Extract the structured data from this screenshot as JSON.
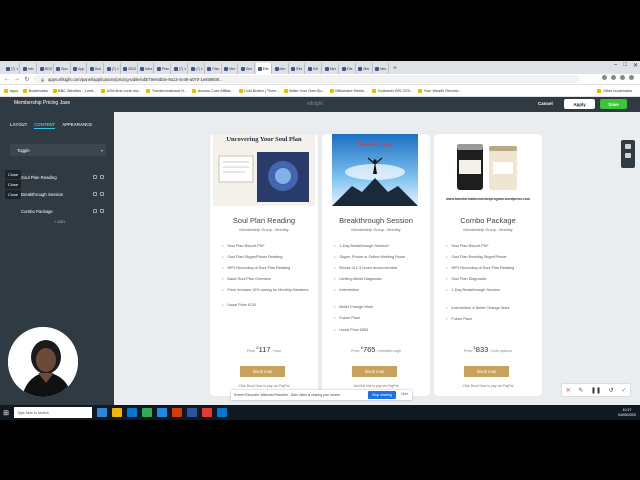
{
  "browser": {
    "tabs": [
      {
        "label": "(7) 1"
      },
      {
        "label": "Info"
      },
      {
        "label": "BOO"
      },
      {
        "label": "Boo"
      },
      {
        "label": "App"
      },
      {
        "label": "Soli"
      },
      {
        "label": "(7) 1"
      },
      {
        "label": "BOO"
      },
      {
        "label": "Inbo"
      },
      {
        "label": "Plan"
      },
      {
        "label": "(7) 1"
      },
      {
        "label": "(7) 1"
      },
      {
        "label": "Plan"
      },
      {
        "label": "Mer"
      },
      {
        "label": "Seo"
      },
      {
        "label": "Elfs"
      },
      {
        "label": "Mer"
      },
      {
        "label": "Elfs"
      },
      {
        "label": "Edi"
      },
      {
        "label": "Mer"
      },
      {
        "label": "Elfs"
      },
      {
        "label": "Mer"
      },
      {
        "label": "Mer"
      }
    ],
    "url": "apps.elfsight.com/panel/applications/pricing-table/edit/79e94b0e-9a13-4e49-a070-1e659806...",
    "bookmarks": [
      "Apps",
      "Bookmarks",
      "BBC Weather - Lond...",
      "USA time zone ma...",
      "Transformational N...",
      "Access Core Affiliat...",
      "Cold Button | Thea...",
      "Make Your Own Bu...",
      "Millionaire Mento...",
      "Godomex BIS-CE0...",
      "Your Wealth Revolut..."
    ],
    "other_bookmarks": "Other bookmarks"
  },
  "app": {
    "widget_name": "Membership Pricing Jase",
    "brand": "elfsight",
    "cancel_label": "Cancel",
    "apply_label": "Apply",
    "save_label": "Save"
  },
  "panel": {
    "tabs": [
      "LAYOUT",
      "CONTENT",
      "APPEARANCE"
    ],
    "active_tab": "CONTENT",
    "toggle_label": "Toggle",
    "items": [
      "Soul Plan Reading",
      "Breakthrough Session",
      "Combo Package"
    ],
    "add_label": "+ ADD",
    "close_tips": [
      "Close",
      "Close",
      "Close"
    ]
  },
  "cards": [
    {
      "image_title": "Uncovering Your Soul Plan",
      "name": "Soul Plan Reading",
      "subtitle": "Membership Group - Monthly",
      "features": [
        "Soul Plan Report PDF",
        "Soul Plan Skype/Phone Reading",
        "MP3 Recording of Soul Plan Reading",
        "Basic Soul Plan Overview",
        "Price includes 10% saving for Monthly Members",
        "Usual Price £130"
      ],
      "price_prefix": "Price",
      "currency": "£",
      "amount": "117",
      "period": "/ hour",
      "button": "Book now",
      "footnote": "Click Book Now to pay via PayPal"
    },
    {
      "image_title": "Breakthrough",
      "name": "Breakthrough Session",
      "subtitle": "Membership Group - Monthly",
      "features": [
        "1-Day Breakthrough Session*",
        "Skype, Phone or Online Meeting Room",
        "Blocks of 2-3 hours recommended",
        "Limiting Belief Diagnostic",
        "Intervention",
        "Belief Change Work",
        "Future Pace",
        "Usual Price £850"
      ],
      "price_prefix": "Price",
      "currency": "£",
      "amount": "765",
      "period": "/ breakthrough",
      "button": "Book now",
      "footnote": "Use the link to pay via PayPal"
    },
    {
      "image_title": "www.transformationmentorprogram.wordpress.com",
      "name": "Combo Package",
      "subtitle": "Membership Group - Monthly",
      "features": [
        "Soul Plan Report PDF",
        "Soul Plan Reading Skype/Phone",
        "MP3 Recording of Soul Plan Reading",
        "Soul Plan Diagnostic",
        "1-Day Breakthrough Session",
        "Intervention & Belief Change Work",
        "Future Pace"
      ],
      "price_prefix": "Price",
      "currency": "£",
      "amount": "833",
      "period": "/ both options",
      "button": "Book now",
      "footnote": "Click Book Now to pay via PayPal"
    }
  ],
  "share_bar": {
    "text": "Screen Recorder, Webcam Recorder - Dabi Video is sharing your screen.",
    "stop_label": "Stop sharing",
    "hide_label": "Hide"
  },
  "taskbar": {
    "search_placeholder": "Type here to search",
    "time": "10:27",
    "date": "04/05/2020"
  },
  "colors": {
    "app_dark": "#2f3a42",
    "accent_blue": "#3ac5e8",
    "save_green": "#3ac53a",
    "book_gold": "#c9a15a",
    "preview_bg": "#e9edf0"
  }
}
